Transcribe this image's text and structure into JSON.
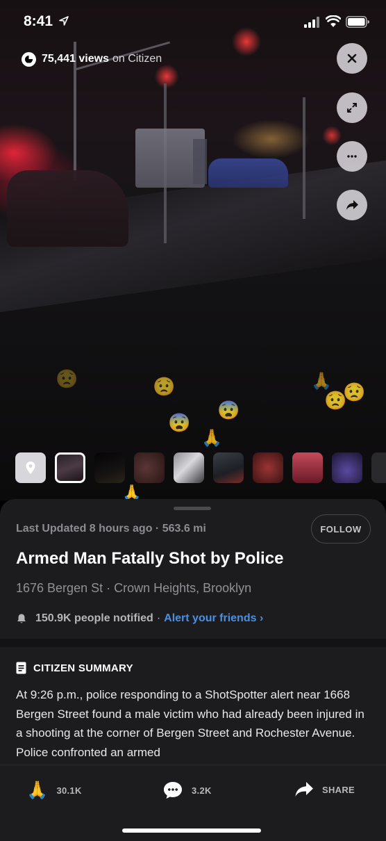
{
  "status_bar": {
    "time": "8:41"
  },
  "views": {
    "count": "75,441 views",
    "suffix": "on Citizen"
  },
  "incident": {
    "updated": "Last Updated 8 hours ago · 563.6 mi",
    "follow_label": "FOLLOW",
    "title": "Armed Man Fatally Shot by Police",
    "address": "1676 Bergen St · Crown Heights, Brooklyn",
    "notified_count": "150.9K people notified",
    "notified_sep": "·",
    "alert_friends": "Alert your friends ›"
  },
  "summary": {
    "heading": "CITIZEN SUMMARY",
    "body": "At 9:26 p.m., police responding to a ShotSpotter alert near 1668 Bergen Street found a male victim who had already been injured in a shooting at the corner of Bergen Street and Rochester Avenue. Police confronted an armed"
  },
  "actions": {
    "pray_count": "30.1K",
    "comment_count": "3.2K",
    "share_label": "SHARE"
  },
  "icons": [
    "location-arrow-icon",
    "signal-icon",
    "wifi-icon",
    "battery-icon",
    "citizen-logo-icon",
    "close-icon",
    "expand-icon",
    "more-icon",
    "share-icon",
    "map-pin-icon",
    "bell-icon",
    "document-icon",
    "pray-icon",
    "comment-icon"
  ],
  "colors": {
    "accent_link": "#4a90e2",
    "sheet_bg": "#1c1c1e"
  }
}
